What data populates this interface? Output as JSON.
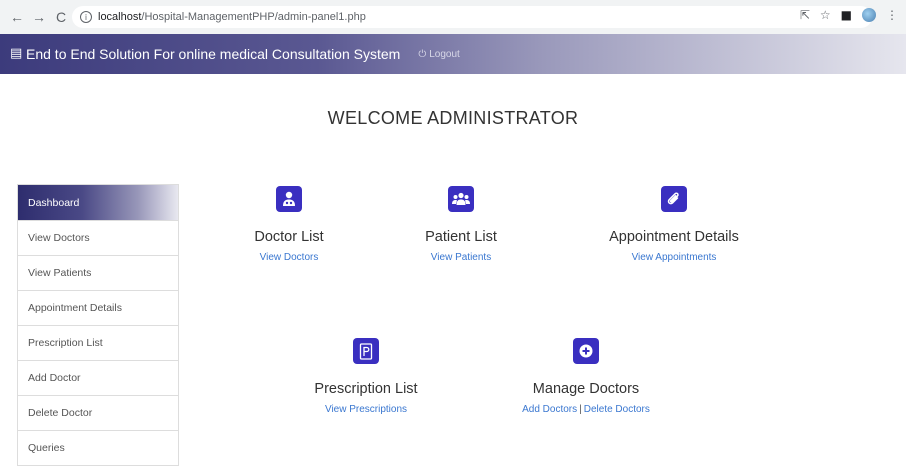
{
  "browser": {
    "back_icon": "←",
    "forward_icon": "→",
    "reload_icon": "C",
    "url_host": "localhost",
    "url_path": "/Hospital-ManagementPHP/admin-panel1.php",
    "right_icons": [
      "share-icon",
      "star-icon",
      "window-icon",
      "profile-avatar",
      "menu-icon"
    ]
  },
  "navbar": {
    "brand": "End to End Solution For online medical Consultation System",
    "logout_label": "Logout"
  },
  "welcome": "WELCOME ADMINISTRATOR",
  "sidebar": {
    "items": [
      {
        "label": "Dashboard"
      },
      {
        "label": "View Doctors"
      },
      {
        "label": "View Patients"
      },
      {
        "label": "Appointment Details"
      },
      {
        "label": "Prescription List"
      },
      {
        "label": "Add Doctor"
      },
      {
        "label": "Delete Doctor"
      },
      {
        "label": "Queries"
      }
    ]
  },
  "cards": {
    "doctor_list": {
      "title": "Doctor List",
      "link": "View Doctors",
      "icon": "doctor-icon"
    },
    "patient_list": {
      "title": "Patient List",
      "link": "View Patients",
      "icon": "users-icon"
    },
    "appointment_details": {
      "title": "Appointment Details",
      "link": "View Appointments",
      "icon": "paperclip-icon"
    },
    "prescription_list": {
      "title": "Prescription List",
      "link": "View Prescriptions",
      "icon": "prescription-icon"
    },
    "manage_doctors": {
      "title": "Manage Doctors",
      "link_add": "Add Doctors",
      "link_separator": "|",
      "link_delete": "Delete Doctors",
      "icon": "plus-circle-icon"
    }
  },
  "colors": {
    "accent": "#3a2fc0",
    "link": "#3a77d0",
    "nav_dark": "#3c3b7c"
  }
}
